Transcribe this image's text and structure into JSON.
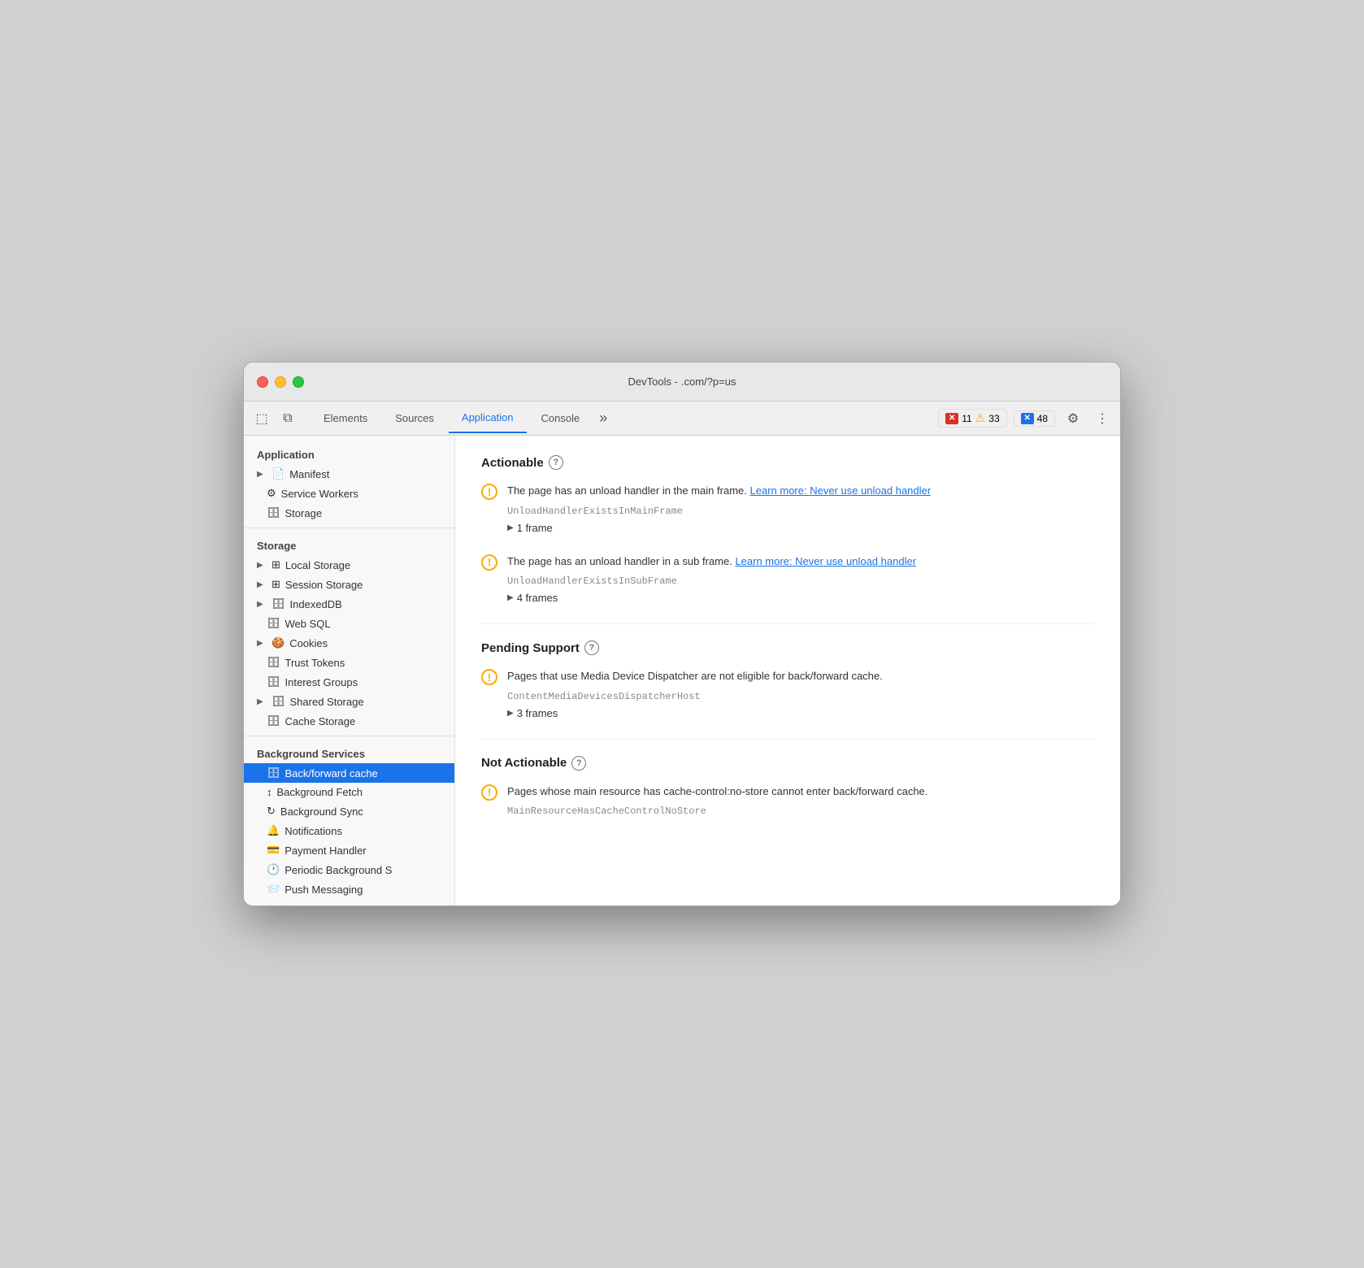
{
  "window": {
    "title_left": "DevTools -",
    "title_right": ".com/?p=us"
  },
  "tabs": {
    "items": [
      {
        "id": "elements",
        "label": "Elements",
        "active": false
      },
      {
        "id": "sources",
        "label": "Sources",
        "active": false
      },
      {
        "id": "application",
        "label": "Application",
        "active": true
      },
      {
        "id": "console",
        "label": "Console",
        "active": false
      }
    ],
    "more_label": "»",
    "badge_errors_count": "11",
    "badge_warnings_count": "33",
    "badge_issues_count": "48"
  },
  "sidebar": {
    "section_application": "Application",
    "items_application": [
      {
        "id": "manifest",
        "label": "Manifest",
        "icon": "📄",
        "arrow": "▶",
        "has_arrow": true
      },
      {
        "id": "service-workers",
        "label": "Service Workers",
        "icon": "⚙",
        "has_arrow": false
      },
      {
        "id": "storage",
        "label": "Storage",
        "icon": "🗄",
        "has_arrow": false
      }
    ],
    "section_storage": "Storage",
    "items_storage": [
      {
        "id": "local-storage",
        "label": "Local Storage",
        "icon": "⊞",
        "arrow": "▶",
        "has_arrow": true
      },
      {
        "id": "session-storage",
        "label": "Session Storage",
        "icon": "⊞",
        "arrow": "▶",
        "has_arrow": true
      },
      {
        "id": "indexeddb",
        "label": "IndexedDB",
        "icon": "🗄",
        "arrow": "▶",
        "has_arrow": true
      },
      {
        "id": "web-sql",
        "label": "Web SQL",
        "icon": "🗄",
        "has_arrow": false
      },
      {
        "id": "cookies",
        "label": "Cookies",
        "icon": "🍪",
        "arrow": "▶",
        "has_arrow": true
      },
      {
        "id": "trust-tokens",
        "label": "Trust Tokens",
        "icon": "🗄",
        "has_arrow": false
      },
      {
        "id": "interest-groups",
        "label": "Interest Groups",
        "icon": "🗄",
        "has_arrow": false
      },
      {
        "id": "shared-storage",
        "label": "Shared Storage",
        "icon": "🗄",
        "arrow": "▶",
        "has_arrow": true
      },
      {
        "id": "cache-storage",
        "label": "Cache Storage",
        "icon": "🗄",
        "has_arrow": false
      }
    ],
    "section_background": "Background Services",
    "items_background": [
      {
        "id": "bfc",
        "label": "Back/forward cache",
        "icon": "🗄",
        "active": true
      },
      {
        "id": "background-fetch",
        "label": "Background Fetch",
        "icon": "↕",
        "active": false
      },
      {
        "id": "background-sync",
        "label": "Background Sync",
        "icon": "↻",
        "active": false
      },
      {
        "id": "notifications",
        "label": "Notifications",
        "icon": "🔔",
        "active": false
      },
      {
        "id": "payment-handler",
        "label": "Payment Handler",
        "icon": "💳",
        "active": false
      },
      {
        "id": "periodic-background",
        "label": "Periodic Background S",
        "icon": "🕐",
        "active": false
      },
      {
        "id": "push-messaging",
        "label": "Push Messaging",
        "icon": "📨",
        "active": false
      }
    ]
  },
  "main": {
    "sections": [
      {
        "id": "actionable",
        "title": "Actionable",
        "issues": [
          {
            "id": "issue-1",
            "text_before": "The page has an unload handler in the main frame.",
            "link_text": "Learn more: Never use unload handler",
            "code": "UnloadHandlerExistsInMainFrame",
            "frames_label": "1 frame"
          },
          {
            "id": "issue-2",
            "text_before": "The page has an unload handler in a sub frame.",
            "link_text": "Learn more: Never use unload handler",
            "code": "UnloadHandlerExistsInSubFrame",
            "frames_label": "4 frames"
          }
        ]
      },
      {
        "id": "pending-support",
        "title": "Pending Support",
        "issues": [
          {
            "id": "issue-3",
            "text_before": "Pages that use Media Device Dispatcher are not eligible for back/forward cache.",
            "link_text": "",
            "code": "ContentMediaDevicesDispatcherHost",
            "frames_label": "3 frames"
          }
        ]
      },
      {
        "id": "not-actionable",
        "title": "Not Actionable",
        "issues": [
          {
            "id": "issue-4",
            "text_before": "Pages whose main resource has cache-control:no-store cannot enter back/forward cache.",
            "link_text": "",
            "code": "MainResourceHasCacheControlNoStore",
            "frames_label": ""
          }
        ]
      }
    ]
  },
  "icons": {
    "cursor": "⬚",
    "layers": "⧉",
    "gear": "⚙",
    "more": "⋮",
    "question": "?"
  }
}
